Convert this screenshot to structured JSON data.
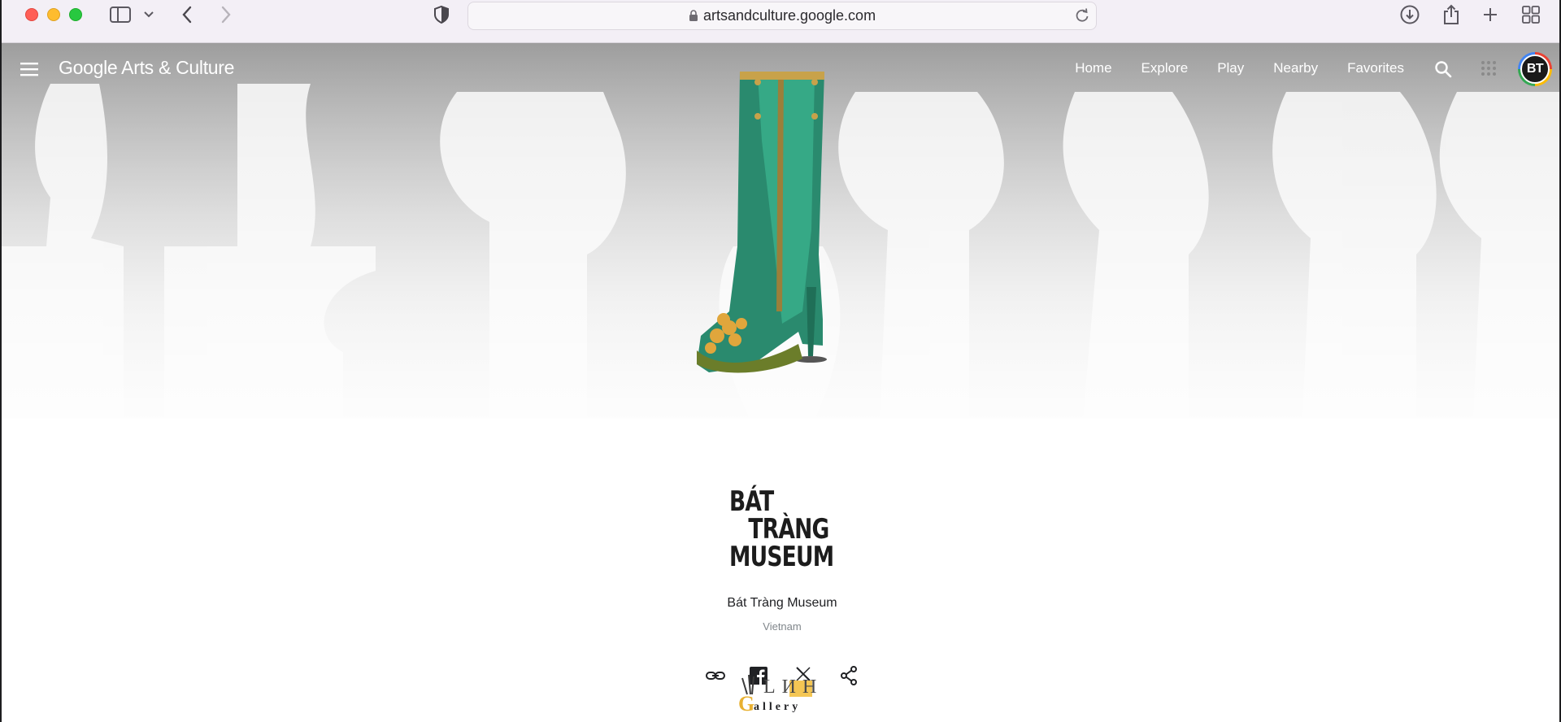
{
  "browser": {
    "url": "artsandculture.google.com",
    "icons": [
      "sidebar-icon",
      "chevron-down-icon",
      "back-icon",
      "forward-icon",
      "privacy-shield-icon",
      "lock-icon",
      "reload-icon",
      "download-icon",
      "share-icon",
      "new-tab-icon",
      "tab-overview-icon"
    ]
  },
  "site_nav": {
    "logo": "Google Arts & Culture",
    "links": [
      "Home",
      "Explore",
      "Play",
      "Nearby",
      "Favorites"
    ],
    "avatar_initials": "BT"
  },
  "museum": {
    "logo_lines": [
      "BÁT",
      "TRÀNG",
      "MUSEUM"
    ],
    "name": "Bát Tràng Museum",
    "country": "Vietnam"
  },
  "share_icons": [
    "link-icon",
    "facebook-icon",
    "x-icon",
    "share-icon"
  ],
  "watermark": {
    "top": "LИH",
    "bottom": "allery",
    "initial": "G"
  }
}
